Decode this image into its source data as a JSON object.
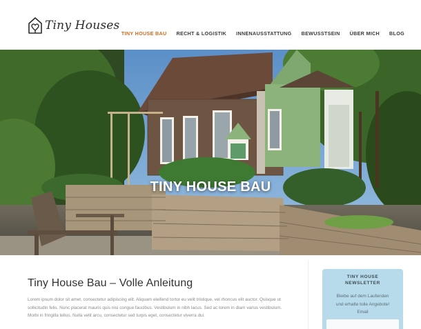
{
  "site": {
    "logo_text": "Tiny Houses",
    "logo_icon": "house-heart-icon"
  },
  "nav": {
    "items": [
      {
        "label": "TINY HOUSE BAU",
        "active": true
      },
      {
        "label": "RECHT & LOGISTIK",
        "active": false
      },
      {
        "label": "INNENAUSSTATTUNG",
        "active": false
      },
      {
        "label": "BEWUSSTSEIN",
        "active": false
      },
      {
        "label": "ÜBER MICH",
        "active": false
      },
      {
        "label": "BLOG",
        "active": false
      }
    ],
    "active_color": "#d2691e"
  },
  "hero": {
    "title": "TINY HOUSE BAU"
  },
  "article": {
    "heading": "Tiny House Bau – Volle Anleitung",
    "body": "Lorem ipsum dolor sit amet, consectetur adipiscing elit. Aliquam eleifend tortor eu velit tristique, vel rhoncus elit auctor. Quisque ut sollicitudin felis. Nunc placerat mauris quis nisi congue faucibus. Vestibulum in nibh lacus. Sed ac lorem in diam varius vestibulum. Morbi in fringilla tellus. Nulla velit arcu, consectetur sed turpis eget, consectetur viverra dui."
  },
  "newsletter": {
    "title_line1": "TINY HOUSE",
    "title_line2": "NEWSLETTER",
    "text_line1": "Bleibe auf dem Laufenden",
    "text_line2": "und erhalte tolle Angebote!",
    "field_label": "Email",
    "background": "#b7dbea"
  }
}
